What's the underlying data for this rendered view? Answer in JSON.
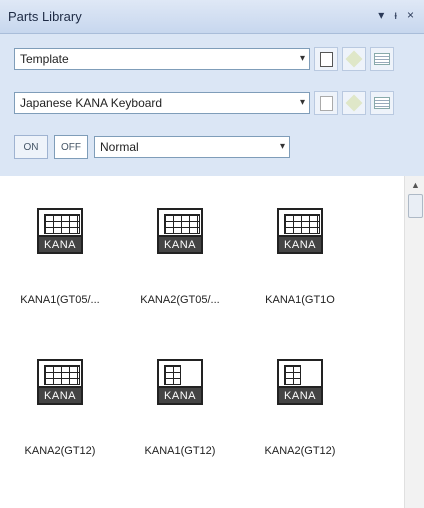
{
  "window": {
    "title": "Parts Library",
    "controls": [
      "▾",
      "ᵻ",
      "×"
    ]
  },
  "row1": {
    "select_value": "Template"
  },
  "row2": {
    "select_value": "Japanese KANA Keyboard"
  },
  "row3": {
    "on_label": "ON",
    "off_label": "OFF",
    "select_value": "Normal"
  },
  "tiles": [
    {
      "caption": "KANA1(GT05/...",
      "icon_text": "KANA",
      "variant": "full"
    },
    {
      "caption": "KANA2(GT05/...",
      "icon_text": "KANA",
      "variant": "full"
    },
    {
      "caption": "KANA1(GT1O",
      "icon_text": "KANA",
      "variant": "full"
    },
    {
      "caption": "KANA2(GT12)",
      "icon_text": "KANA",
      "variant": "full"
    },
    {
      "caption": "KANA1(GT12)",
      "icon_text": "KANA",
      "variant": "small"
    },
    {
      "caption": "KANA2(GT12)",
      "icon_text": "KANA",
      "variant": "small"
    }
  ]
}
